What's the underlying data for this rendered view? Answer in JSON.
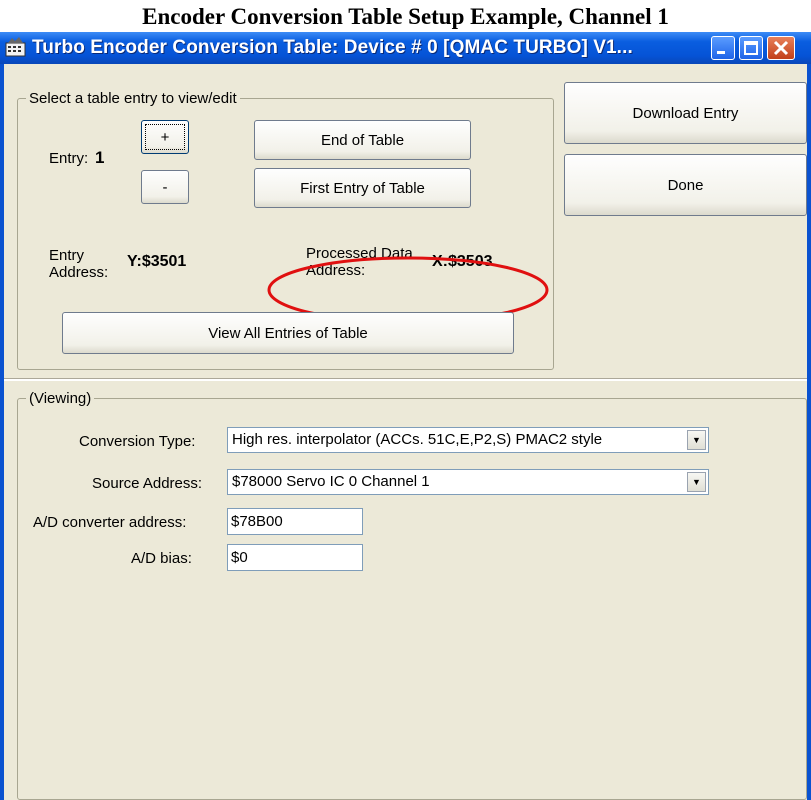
{
  "caption": "Encoder Conversion Table Setup Example, Channel 1",
  "window": {
    "title": "Turbo Encoder Conversion Table: Device # 0 [QMAC TURBO] V1...",
    "icon": "app-icon"
  },
  "select_group": {
    "legend": "Select a table entry to view/edit",
    "entry_label": "Entry:",
    "entry_value": "1",
    "plus_label": "+",
    "minus_label": "-",
    "end_of_table": "End of Table",
    "first_entry": "First Entry of Table",
    "entry_address_label": "Entry\nAddress:",
    "entry_address_value": "Y:$3501",
    "processed_label": "Processed Data\nAddress:",
    "processed_value": "X:$3503",
    "view_all": "View All Entries of Table"
  },
  "actions": {
    "download": "Download Entry",
    "done": "Done"
  },
  "viewing": {
    "legend": "(Viewing)",
    "conversion_type_label": "Conversion Type:",
    "conversion_type_value": "High res. interpolator (ACCs. 51C,E,P2,S) PMAC2 style",
    "source_address_label": "Source Address:",
    "source_address_value": "$78000 Servo IC 0 Channel 1",
    "ad_converter_label": "A/D converter address:",
    "ad_converter_value": "$78B00",
    "ad_bias_label": "A/D bias:",
    "ad_bias_value": "$0"
  },
  "colors": {
    "highlight": "#e01010",
    "titlebar": "#0553d6",
    "window_bg": "#ece9d8"
  }
}
